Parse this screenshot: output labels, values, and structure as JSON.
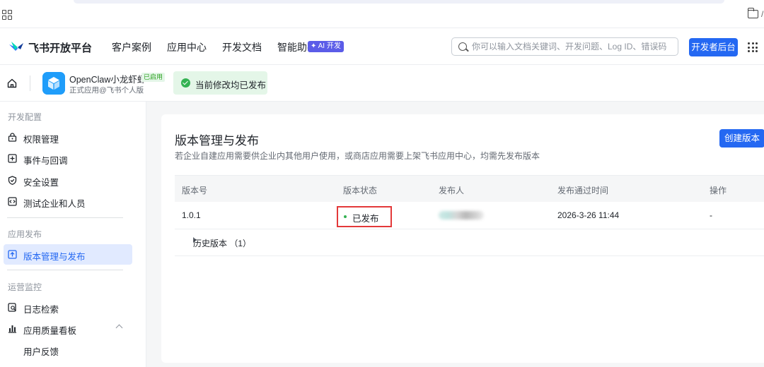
{
  "header": {
    "brand": "飞书开放平台",
    "nav": [
      "客户案例",
      "应用中心",
      "开发文档",
      "智能助手"
    ],
    "ai_badge": "✦ AI 开发",
    "search_placeholder": "你可以输入文档关键词、开发问题、Log ID、错误码",
    "dev_console": "开发者后台"
  },
  "app": {
    "name": "OpenClaw小龙虾虾",
    "enabled_tag": "已启用",
    "subtitle": "正式应用@飞书个人版",
    "publish_banner": "当前修改均已发布"
  },
  "sidebar": {
    "group_dev": "开发配置",
    "permission": "权限管理",
    "events": "事件与回调",
    "security": "安全设置",
    "test_users": "测试企业和人员",
    "group_release": "应用发布",
    "version_mgmt": "版本管理与发布",
    "group_ops": "运营监控",
    "log_search": "日志检索",
    "quality_board": "应用质量看板",
    "user_feedback": "用户反馈"
  },
  "main": {
    "title": "版本管理与发布",
    "description": "若企业自建应用需要供企业内其他用户使用，或商店应用需要上架飞书应用中心，均需先发布版本",
    "create_button": "创建版本",
    "columns": {
      "version": "版本号",
      "status": "版本状态",
      "publisher": "发布人",
      "approved_time": "发布通过时间",
      "actions": "操作"
    },
    "row": {
      "version": "1.0.1",
      "status": "已发布",
      "approved_time": "2026-3-26 11:44",
      "actions": "-"
    },
    "history": "历史版本 （1）"
  },
  "colors": {
    "primary": "#2468f2",
    "success": "#34b253",
    "highlight": "#e3393a"
  }
}
